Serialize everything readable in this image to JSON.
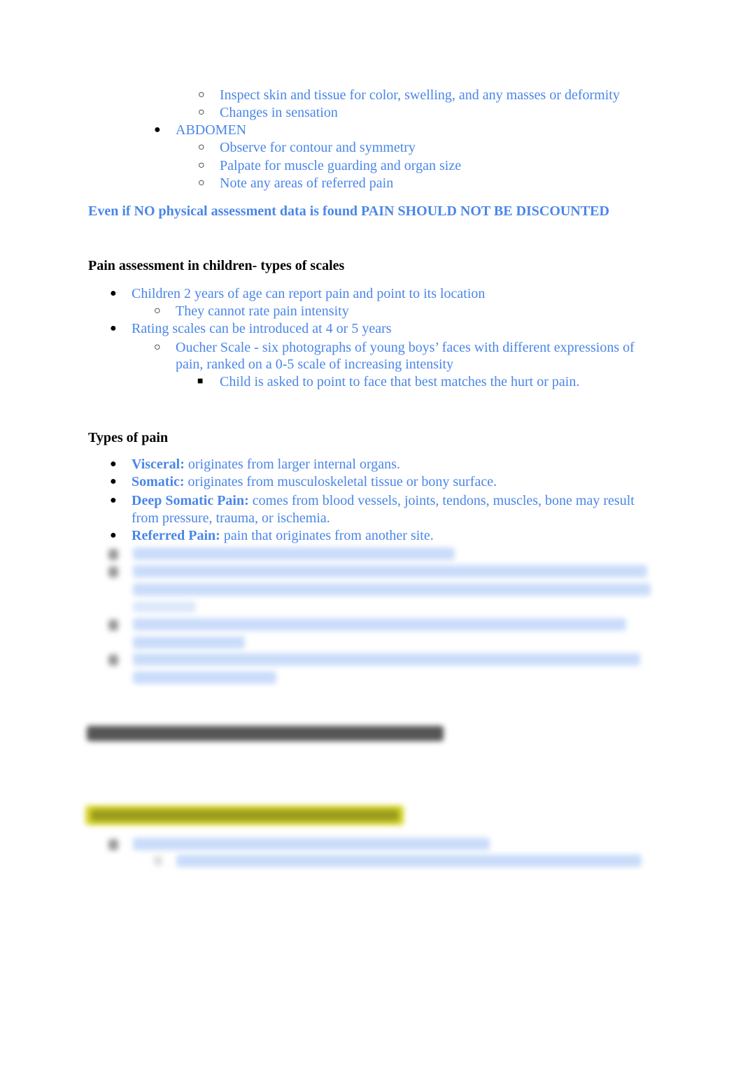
{
  "colors": {
    "accent": "#4a86e8",
    "text": "#000000",
    "highlight": "#e6e600"
  },
  "top_list": {
    "items": [
      {
        "level": 3,
        "text": "Inspect skin and tissue for color, swelling, and any masses or deformity"
      },
      {
        "level": 3,
        "text": "Changes in sensation"
      },
      {
        "level": 2,
        "text": "ABDOMEN"
      },
      {
        "level": 3,
        "text": "Observe for contour and symmetry"
      },
      {
        "level": 3,
        "text": "Palpate for muscle guarding and organ size"
      },
      {
        "level": 3,
        "text": "Note any areas of referred pain"
      }
    ]
  },
  "note": "Even if NO physical assessment data is found PAIN SHOULD NOT BE DISCOUNTED",
  "children_section": {
    "heading": "Pain assessment in children- types of scales",
    "items": [
      "Children 2 years of age can report pain and point to its location",
      "They cannot rate pain intensity",
      "Rating scales can be introduced at 4 or 5 years",
      "Oucher Scale - six photographs of young boys’ faces with different expressions of",
      "pain, ranked on a 0-5 scale of increasing intensity",
      "Child is asked to point to face that best matches the hurt or pain."
    ]
  },
  "types_section": {
    "heading": "Types of pain",
    "items": [
      {
        "term": "Visceral:",
        "desc": "originates from larger internal organs."
      },
      {
        "term": "Somatic:",
        "desc": "originates from musculoskeletal tissue or bony surface."
      },
      {
        "term": "Deep Somatic Pain:",
        "desc": "comes from blood vessels, joints, tendons, muscles, bone may result",
        "cont": "from pressure, trauma, or ischemia."
      },
      {
        "term": "Referred Pain:",
        "desc": "pain that originates from another site."
      }
    ]
  }
}
